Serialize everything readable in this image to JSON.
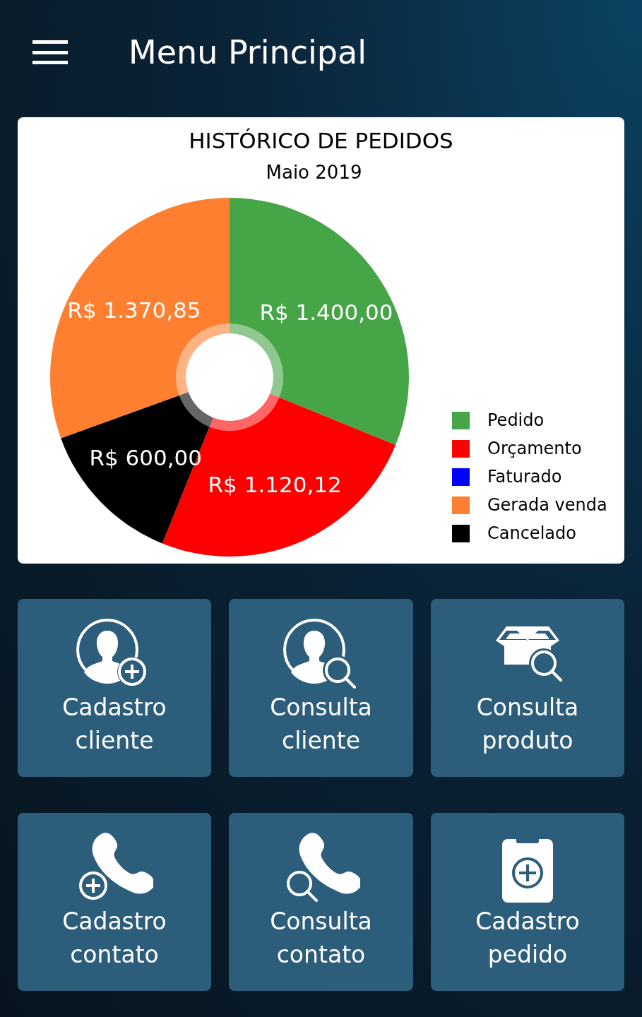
{
  "app_bar": {
    "title": "Menu Principal"
  },
  "chart_card": {
    "title": "HISTÓRICO DE PEDIDOS",
    "subtitle": "Maio 2019",
    "chart_data": {
      "type": "donut",
      "values": [
        1400.0,
        1120.12,
        600.0,
        1370.85
      ],
      "colors": [
        "#46a546",
        "#ff0000",
        "#000000",
        "#ff7f30"
      ],
      "value_labels": [
        "R$ 1.400,00",
        "R$ 1.120,12",
        "R$ 600,00",
        "R$ 1.370,85"
      ]
    },
    "legend": [
      {
        "label": "Pedido",
        "color": "#46a546"
      },
      {
        "label": "Orçamento",
        "color": "#ff0000"
      },
      {
        "label": "Faturado",
        "color": "#0000ff"
      },
      {
        "label": "Gerada venda",
        "color": "#ff7f30"
      },
      {
        "label": "Cancelado",
        "color": "#000000"
      }
    ]
  },
  "tiles": [
    {
      "lines": [
        "Cadastro",
        "cliente"
      ]
    },
    {
      "lines": [
        "Consulta",
        "cliente"
      ]
    },
    {
      "lines": [
        "Consulta",
        "produto"
      ]
    },
    {
      "lines": [
        "Cadastro",
        "contato"
      ]
    },
    {
      "lines": [
        "Consulta",
        "contato"
      ]
    },
    {
      "lines": [
        "Cadastro",
        "pedido"
      ]
    }
  ]
}
